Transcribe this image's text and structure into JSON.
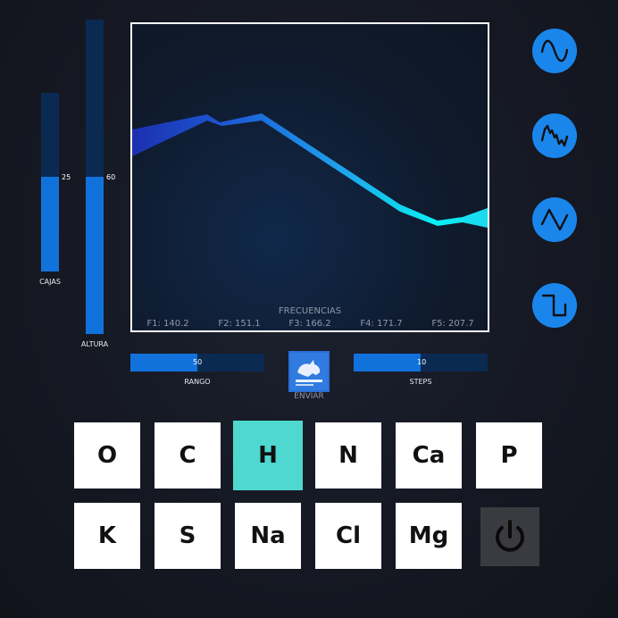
{
  "sliders": {
    "cajas": {
      "label": "CAJAS",
      "value": "25",
      "fraction": 0.53
    },
    "altura": {
      "label": "ALTURA",
      "value": "60",
      "fraction": 0.49
    }
  },
  "plot": {
    "title": "FRECUENCIAS",
    "frequencies": [
      "F1: 140.2",
      "F2: 151.1",
      "F3: 166.2",
      "F4: 171.7",
      "F5: 207.7"
    ]
  },
  "waveforms": [
    {
      "name": "sine",
      "icon": "sine-wave-icon"
    },
    {
      "name": "noisy",
      "icon": "noisy-wave-icon"
    },
    {
      "name": "triangle",
      "icon": "triangle-wave-icon"
    },
    {
      "name": "square",
      "icon": "square-wave-icon"
    }
  ],
  "rango": {
    "label": "RANGO",
    "value": "50",
    "fraction": 0.5
  },
  "steps": {
    "label": "STEPS",
    "value": "10",
    "fraction": 0.5
  },
  "send": {
    "label": "ENVIAR",
    "icon": "rhino-logo-icon"
  },
  "elements": [
    {
      "symbol": "O",
      "selected": false
    },
    {
      "symbol": "C",
      "selected": false
    },
    {
      "symbol": "H",
      "selected": true
    },
    {
      "symbol": "N",
      "selected": false
    },
    {
      "symbol": "Ca",
      "selected": false
    },
    {
      "symbol": "P",
      "selected": false
    },
    {
      "symbol": "K",
      "selected": false
    },
    {
      "symbol": "S",
      "selected": false
    },
    {
      "symbol": "Na",
      "selected": false
    },
    {
      "symbol": "Cl",
      "selected": false
    },
    {
      "symbol": "Mg",
      "selected": false
    }
  ],
  "power": {
    "icon": "power-icon"
  },
  "colors": {
    "accent": "#1a86ec",
    "selected": "#4ed8d0",
    "track": "#0b2a52",
    "fill": "#1272dc"
  }
}
